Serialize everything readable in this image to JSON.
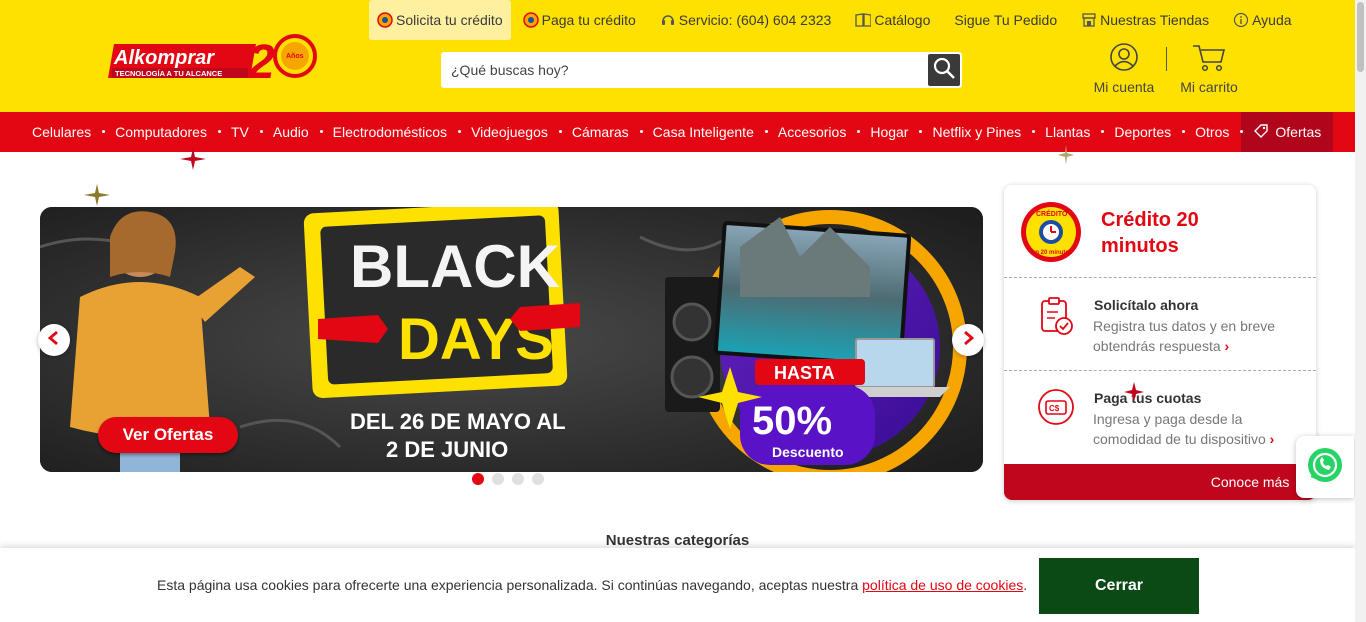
{
  "header": {
    "logo": {
      "brand": "Alkomprar",
      "tagline": "TECNOLOGÍA A TU ALCANCE",
      "anniversary": "20",
      "anniversary_label": "Años"
    },
    "top_links": [
      {
        "label": "Solicita tu crédito",
        "icon": "credit-coin-icon"
      },
      {
        "label": "Paga tu crédito",
        "icon": "credit-coin-icon"
      },
      {
        "label": "Servicio: (604) 604 2323",
        "icon": "headset-icon"
      },
      {
        "label": "Catálogo",
        "icon": "catalog-icon"
      },
      {
        "label": "Sigue Tu Pedido",
        "icon": ""
      },
      {
        "label": "Nuestras Tiendas",
        "icon": "store-icon"
      },
      {
        "label": "Ayuda",
        "icon": "info-icon"
      }
    ],
    "search": {
      "placeholder": "¿Qué buscas hoy?",
      "value": ""
    },
    "account_label": "Mi cuenta",
    "cart_label": "Mi carrito"
  },
  "nav": {
    "items": [
      "Celulares",
      "Computadores",
      "TV",
      "Audio",
      "Electrodomésticos",
      "Videojuegos",
      "Cámaras",
      "Casa Inteligente",
      "Accesorios",
      "Hogar",
      "Netflix y Pines",
      "Llantas",
      "Deportes",
      "Otros"
    ],
    "offers_label": "Ofertas"
  },
  "banner": {
    "title_line1": "BLACK",
    "title_line2": "DAYS",
    "dates_line1": "DEL 26 DE MAYO AL",
    "dates_line2": "2 DE JUNIO",
    "cta": "Ver Ofertas",
    "promo_prefix": "HASTA",
    "promo_value": "50%",
    "promo_suffix": "Descuento",
    "slide_count": 4,
    "active_slide": 1
  },
  "credit_card": {
    "badge_top": "CRÉDITO",
    "badge_bottom": "en 20 minutos",
    "title": "Crédito 20 minutos",
    "rows": [
      {
        "title": "Solicítalo ahora",
        "desc": "Registra tus datos y en breve obtendrás respuesta",
        "icon": "clipboard-check-icon"
      },
      {
        "title": "Paga tus cuotas",
        "desc": "Ingresa y paga desde la comodidad de tu dispositivo",
        "icon": "payment-card-icon"
      }
    ],
    "cta": "Conoce más"
  },
  "sections": {
    "categories_title": "Nuestras categorías"
  },
  "cookie_banner": {
    "text": "Esta página usa cookies para ofrecerte una experiencia personalizada. Si continúas navegando, aceptas nuestra",
    "link": "política de uso de cookies",
    "end": ".",
    "button": "Cerrar"
  },
  "colors": {
    "yellow": "#ffe100",
    "red": "#e30613",
    "dark_red": "#b0051b",
    "cookie_green": "#0b4a15"
  }
}
